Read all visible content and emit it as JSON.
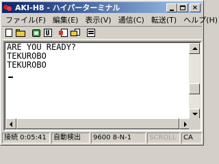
{
  "window": {
    "title": "AKI-H8 - ハイパーターミナル",
    "min_glyph": "",
    "max_glyph": "",
    "close_glyph": "×"
  },
  "menu": {
    "items": [
      "ファイル(F)",
      "編集(E)",
      "表示(V)",
      "通信(C)",
      "転送(T)",
      "ヘルプ(H)"
    ]
  },
  "toolbar": {
    "icons": [
      "new-connection-icon",
      "open-icon",
      "connect-icon",
      "disconnect-icon",
      "send-icon",
      "receive-icon",
      "properties-icon"
    ]
  },
  "terminal": {
    "lines": [
      "ARE YOU READY?",
      "TEKUROBO",
      "TEKUROBO",
      ""
    ]
  },
  "status": {
    "time": "接続 0:05:41",
    "detect": "自動検出",
    "settings": "9600 8-N-1",
    "scroll": "SCROLL",
    "caps": "CA"
  },
  "colors": {
    "title_start": "#0a246a",
    "title_end": "#a6caf0",
    "chrome": "#d4d0c8"
  }
}
